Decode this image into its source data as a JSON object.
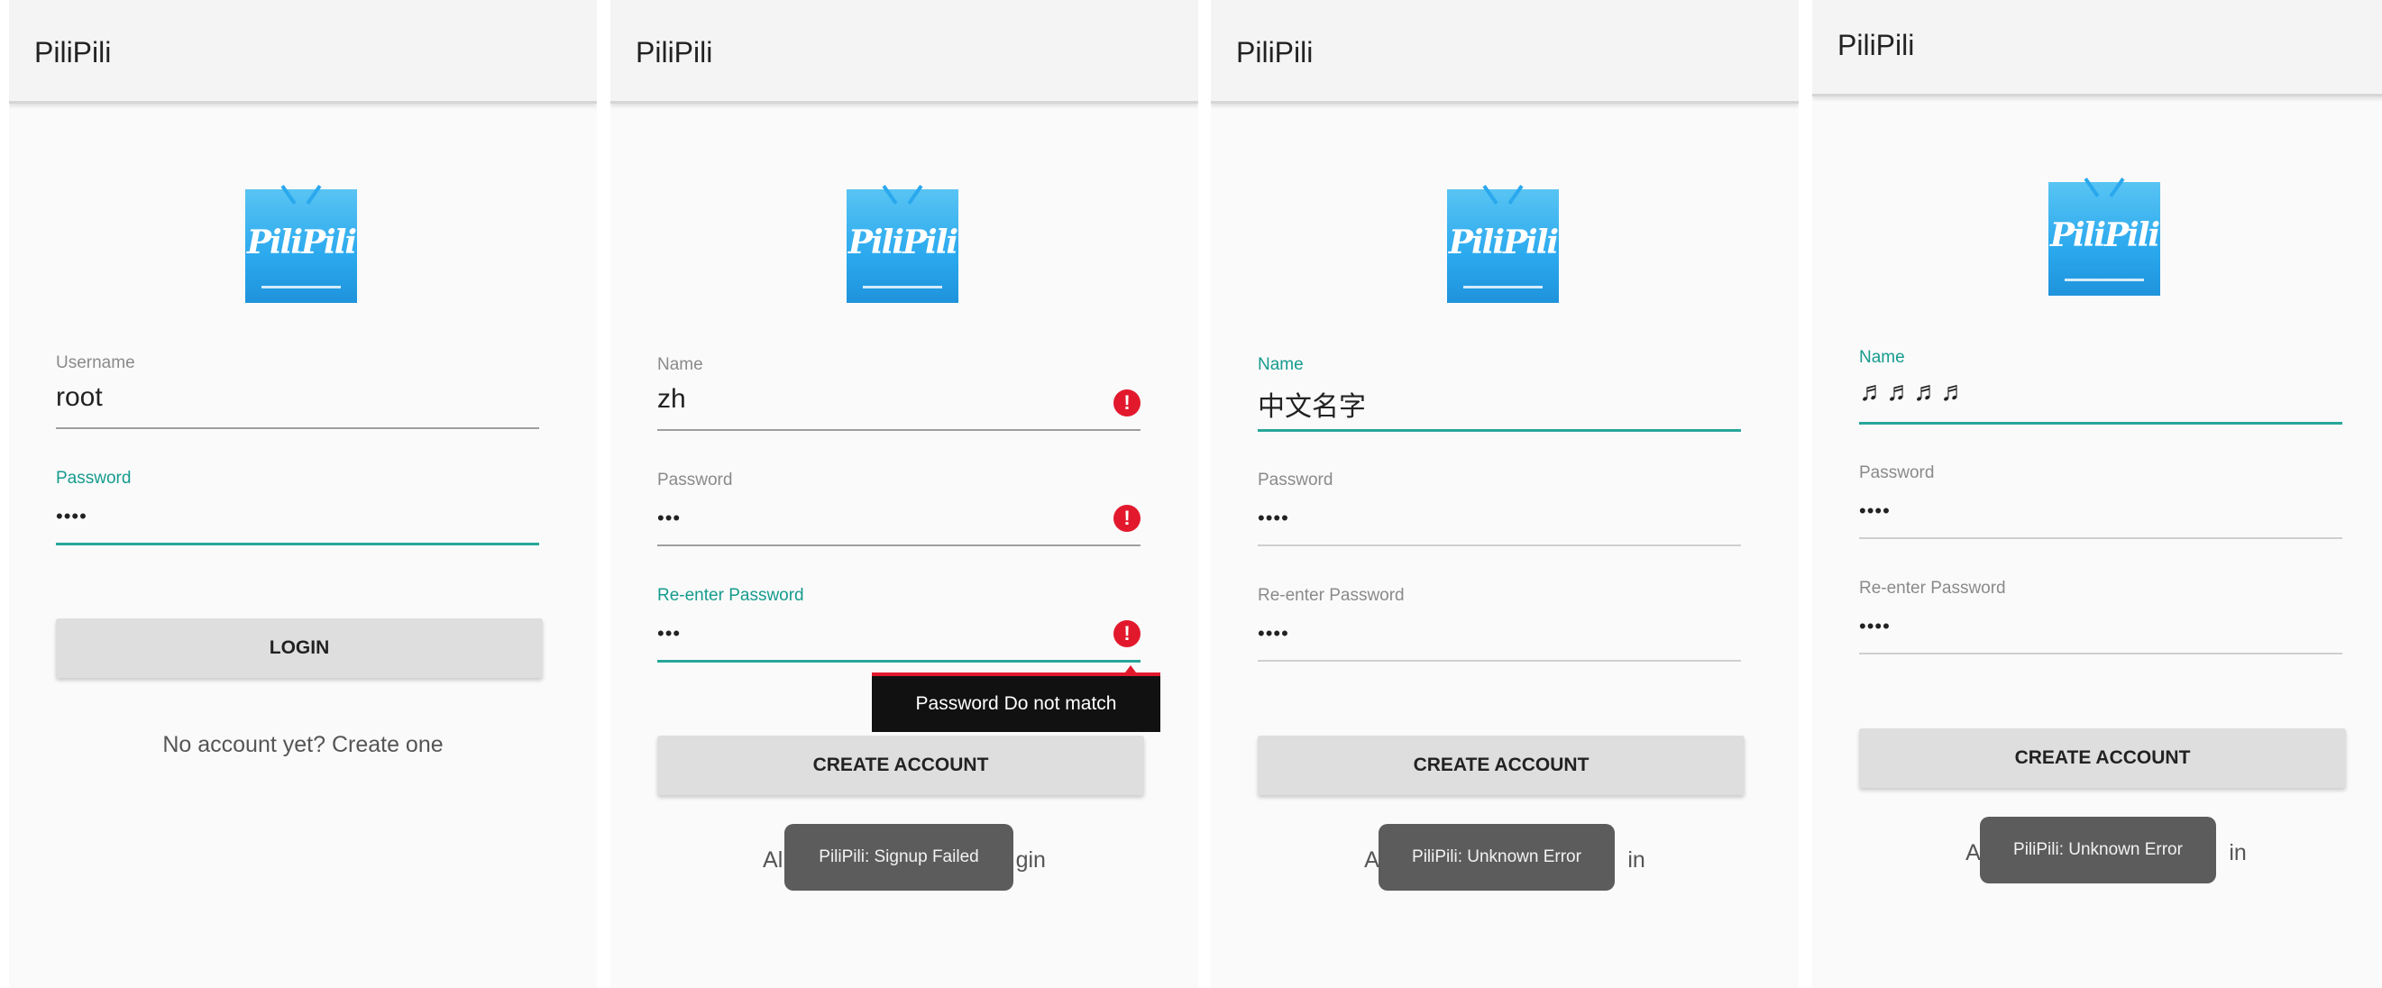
{
  "app": {
    "title": "PiliPili",
    "logo_text": "PiliPili"
  },
  "colors": {
    "accent": "#29a699",
    "error": "#e2192d",
    "appbar": "#f4f4f4",
    "toast": "#5c5c5c"
  },
  "screen1": {
    "username": {
      "label": "Username",
      "value": "root"
    },
    "password": {
      "label": "Password",
      "value": "••••"
    },
    "login_button": "LOGIN",
    "create_link": "No account yet? Create one"
  },
  "screen2": {
    "name": {
      "label": "Name",
      "value": "zh"
    },
    "password": {
      "label": "Password",
      "value": "•••"
    },
    "reenter": {
      "label": "Re-enter Password",
      "value": "•••"
    },
    "error_icon": "!",
    "tooltip": "Password Do not match",
    "create_button": "CREATE ACCOUNT",
    "login_link_left": "Alr",
    "login_link_right": "gin",
    "toast": "PiliPili: Signup Failed"
  },
  "screen3": {
    "name": {
      "label": "Name",
      "value": "中文名字"
    },
    "password": {
      "label": "Password",
      "value": "••••"
    },
    "reenter": {
      "label": "Re-enter Password",
      "value": "••••"
    },
    "create_button": "CREATE ACCOUNT",
    "login_link_left": "Al",
    "login_link_right": "in",
    "toast": "PiliPili: Unknown Error"
  },
  "screen4": {
    "name": {
      "label": "Name",
      "value": "♬♬♬♬"
    },
    "password": {
      "label": "Password",
      "value": "••••"
    },
    "reenter": {
      "label": "Re-enter Password",
      "value": "••••"
    },
    "create_button": "CREATE ACCOUNT",
    "login_link_left": "Al",
    "login_link_right": "in",
    "toast": "PiliPili: Unknown Error"
  }
}
